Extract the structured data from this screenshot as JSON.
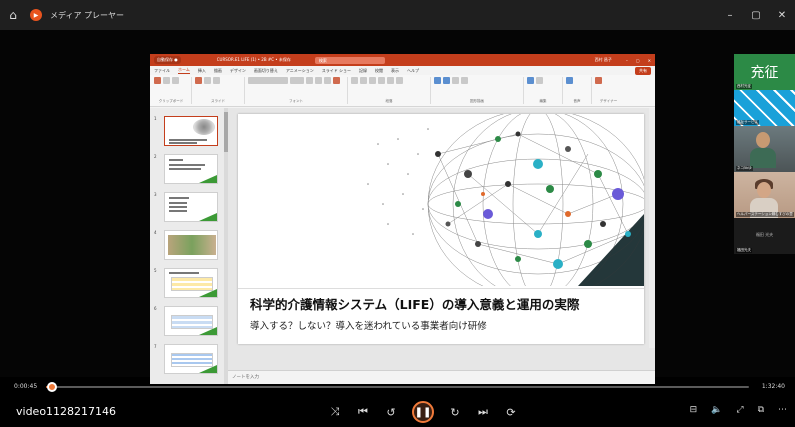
{
  "player": {
    "home_icon": "⌂",
    "title": "メディア プレーヤー",
    "win_min": "–",
    "win_max": "▢",
    "win_close": "✕"
  },
  "ppt": {
    "autosave": "自動保存 ●",
    "doc_title": "CURSOR.E1 LIFE (1) • 2B #C • 未保存",
    "search": "検索",
    "user": "西村 昌子",
    "tabs": [
      "ファイル",
      "ホーム",
      "挿入",
      "描画",
      "デザイン",
      "画面切り替え",
      "アニメーション",
      "スライド ショー",
      "記録",
      "校閲",
      "表示",
      "ヘルプ"
    ],
    "active_tab": "ホーム",
    "share": "共有",
    "ribbon_groups": [
      "クリップボード",
      "スライド",
      "フォント",
      "段落",
      "図形描画",
      "編集",
      "音声",
      "デザイナー"
    ],
    "notes_placeholder": "ノートを入力",
    "slide_numbers": [
      "1",
      "2",
      "3",
      "4",
      "5",
      "6",
      "7"
    ]
  },
  "slide": {
    "title": "科学的介護情報システム（LIFE）の導入意義と運用の実際",
    "subtitle": "導入する？しない？導入を迷われている事業者向け研修"
  },
  "participants": {
    "name_card": "充征",
    "name_label": "西村光征",
    "p2_label": "福祉サービス",
    "p3_label": "ネコ5kゆ",
    "p4_label": "ヘルパーステーション縁むすびの里",
    "p5_center": "福田 光夫",
    "p5_label": "福田光夫"
  },
  "timeline": {
    "current": "0:00:45",
    "total": "1:32:40",
    "progress": 0.008
  },
  "controls": {
    "video_name": "video1128217146",
    "shuffle": "⤨",
    "prev": "⏮",
    "rewind": "↺",
    "play_pause": "❚❚",
    "forward": "↻",
    "next": "⏭",
    "repeat": "⟳",
    "subtitle": "⊟",
    "volume": "🔈",
    "fullscreen": "⤢",
    "miniplayer": "⧉",
    "more": "⋯"
  }
}
